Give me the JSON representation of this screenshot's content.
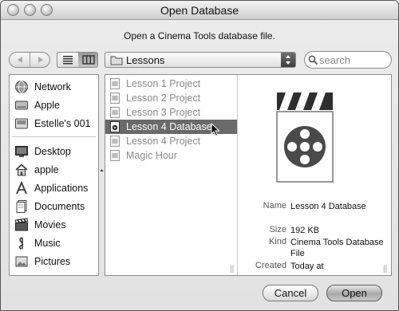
{
  "window": {
    "title": "Open Database"
  },
  "prompt": "Open a Cinema Tools database file.",
  "toolbar": {
    "back_icon": "back-arrow-icon",
    "forward_icon": "forward-arrow-icon",
    "location": "Lessons",
    "search_placeholder": "search"
  },
  "sidebar": {
    "devices": [
      {
        "label": "Network",
        "icon": "network-globe-icon"
      },
      {
        "label": "Apple",
        "icon": "hard-drive-icon"
      },
      {
        "label": "Estelle's 001",
        "icon": "disk-icon"
      }
    ],
    "places": [
      {
        "label": "Desktop",
        "icon": "desktop-icon"
      },
      {
        "label": "apple",
        "icon": "home-icon"
      },
      {
        "label": "Applications",
        "icon": "applications-icon"
      },
      {
        "label": "Documents",
        "icon": "documents-icon"
      },
      {
        "label": "Movies",
        "icon": "movies-icon"
      },
      {
        "label": "Music",
        "icon": "music-icon"
      },
      {
        "label": "Pictures",
        "icon": "pictures-icon"
      }
    ]
  },
  "files": [
    {
      "label": "Lesson 1 Project",
      "selected": false
    },
    {
      "label": "Lesson 2 Project",
      "selected": false
    },
    {
      "label": "Lesson 3 Project",
      "selected": false
    },
    {
      "label": "Lesson 4 Database",
      "selected": true
    },
    {
      "label": "Lesson 4 Project",
      "selected": false
    },
    {
      "label": "Magic Hour",
      "selected": false
    }
  ],
  "preview": {
    "icon": "cinema-tools-database-icon",
    "name_key": "Name",
    "name_val": "Lesson 4 Database",
    "size_key": "Size",
    "size_val": "192 KB",
    "kind_key": "Kind",
    "kind_val": "Cinema Tools Database File",
    "created_key": "Created",
    "created_val": "Today at"
  },
  "buttons": {
    "cancel": "Cancel",
    "open": "Open"
  }
}
